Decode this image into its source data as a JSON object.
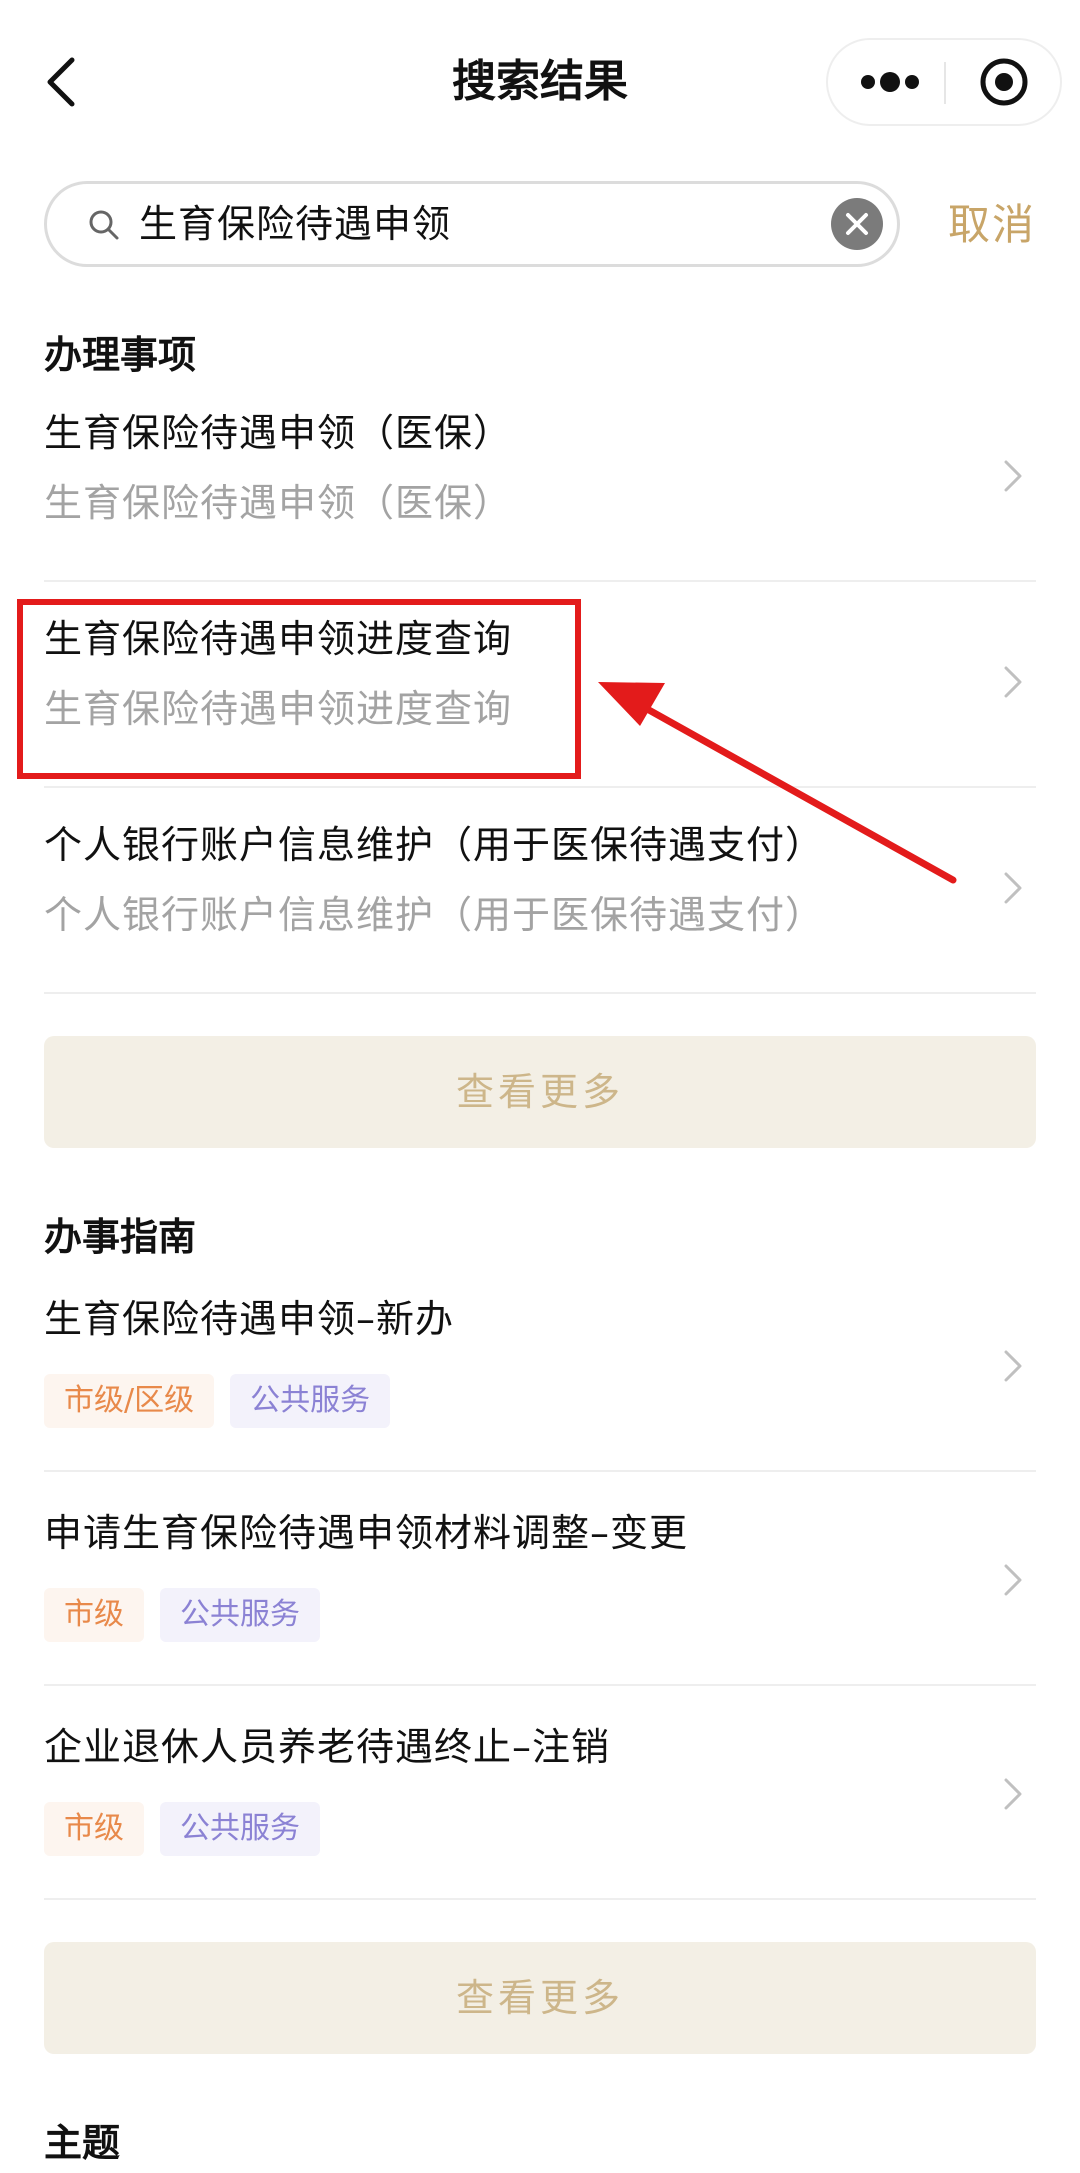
{
  "header": {
    "title": "搜索结果",
    "back_icon": "chevron-left-icon",
    "more_icon": "more-dots-icon",
    "target_icon": "target-icon"
  },
  "search": {
    "query": "生育保险待遇申领",
    "cancel_label": "取消",
    "search_icon": "search-icon",
    "clear_icon": "clear-icon"
  },
  "sections": {
    "items": {
      "title": "办理事项",
      "rows": [
        {
          "title": "生育保险待遇申领（医保）",
          "subtitle": "生育保险待遇申领（医保）"
        },
        {
          "title": "生育保险待遇申领进度查询",
          "subtitle": "生育保险待遇申领进度查询"
        },
        {
          "title": "个人银行账户信息维护（用于医保待遇支付）",
          "subtitle": "个人银行账户信息维护（用于医保待遇支付）"
        }
      ],
      "more_label": "查看更多"
    },
    "guides": {
      "title": "办事指南",
      "rows": [
        {
          "title": "生育保险待遇申领–新办",
          "tags": [
            "市级/区级",
            "公共服务"
          ]
        },
        {
          "title": "申请生育保险待遇申领材料调整–变更",
          "tags": [
            "市级",
            "公共服务"
          ]
        },
        {
          "title": "企业退休人员养老待遇终止–注销",
          "tags": [
            "市级",
            "公共服务"
          ]
        }
      ],
      "more_label": "查看更多"
    },
    "topics": {
      "title": "主题"
    }
  },
  "colors": {
    "accent": "#c8a568",
    "annotation": "#e31b1b",
    "tag_level_text": "#e8894a",
    "tag_type_text": "#8b82d4",
    "more_button_bg": "#f3efe5"
  }
}
